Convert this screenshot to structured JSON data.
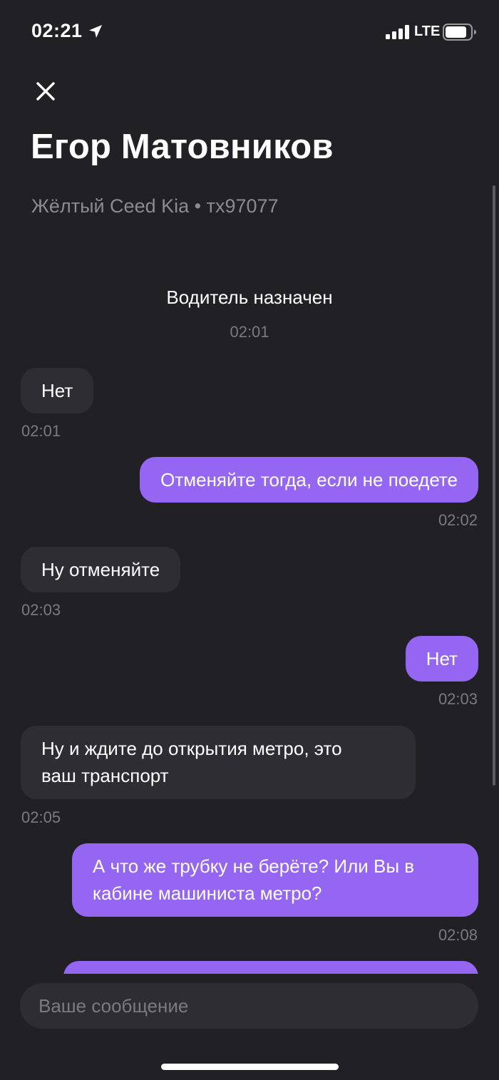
{
  "status_bar": {
    "time": "02:21",
    "network": "LTE",
    "icons": [
      "location-arrow-icon",
      "signal-icon",
      "battery-icon"
    ]
  },
  "header": {
    "close_icon": "close-icon",
    "driver_name": "Егор Матовников",
    "car_info": "Жёлтый Ceed Kia • тх97077"
  },
  "chat": {
    "system_message": {
      "text": "Водитель назначен",
      "time": "02:01"
    },
    "messages": [
      {
        "direction": "incoming",
        "lines": [
          "Нет"
        ],
        "time": "02:01"
      },
      {
        "direction": "outgoing",
        "lines": [
          "Отменяйте тогда, если не поедете"
        ],
        "time": "02:02"
      },
      {
        "direction": "incoming",
        "lines": [
          "Ну отменяйте"
        ],
        "time": "02:03"
      },
      {
        "direction": "outgoing",
        "lines": [
          "Нет"
        ],
        "time": "02:03"
      },
      {
        "direction": "incoming",
        "lines": [
          "Ну и ждите до открытия метро,  это",
          "ваш транспорт"
        ],
        "time": "02:05"
      },
      {
        "direction": "outgoing",
        "lines": [
          "А что же трубку не берёте? Или Вы в",
          "кабине машиниста метро?"
        ],
        "time": "02:08"
      },
      {
        "direction": "outgoing",
        "lines": [
          ""
        ],
        "time": ""
      }
    ]
  },
  "composer": {
    "placeholder": "Ваше сообщение"
  },
  "colors": {
    "background": "#212025",
    "incoming_bubble": "#2e2d33",
    "outgoing_bubble": "#9466f2",
    "secondary_text": "#8c8b90"
  }
}
